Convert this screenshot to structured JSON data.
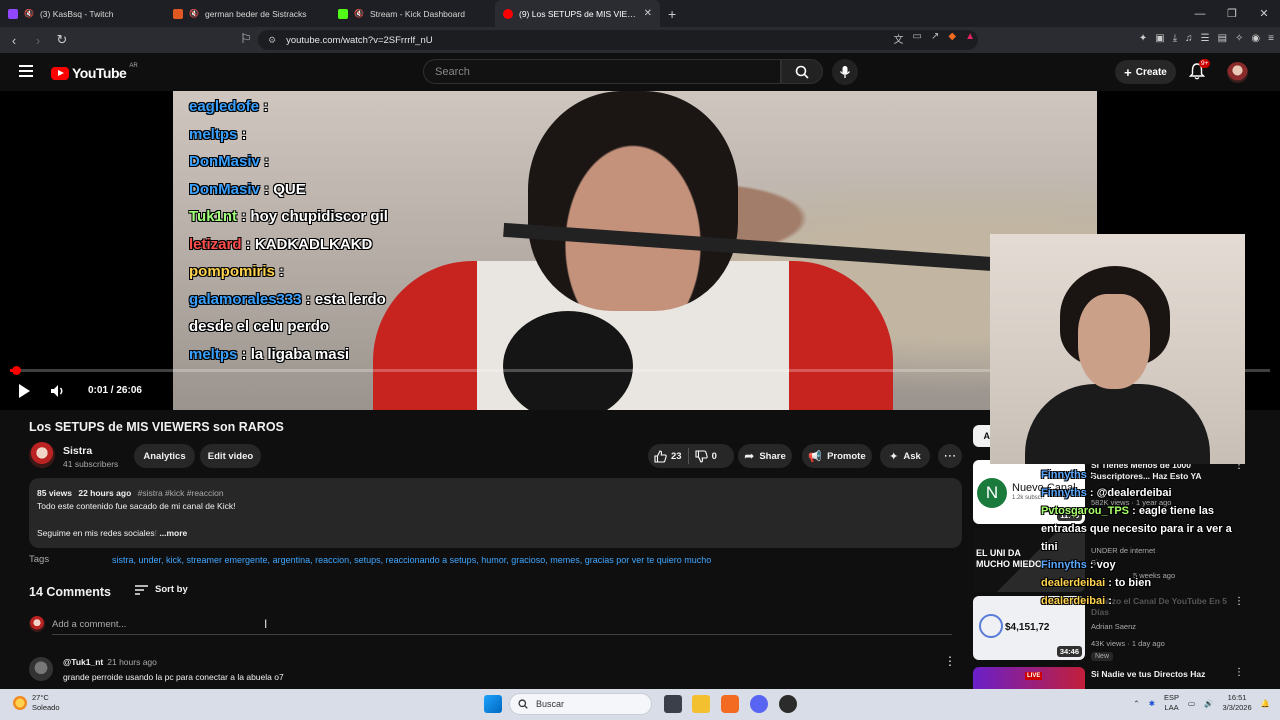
{
  "browser": {
    "tabs": [
      {
        "title": "(3) KasBsq - Twitch",
        "favicon_color": "#9146ff",
        "muted": true,
        "active": false
      },
      {
        "title": "german beder de Sistracks",
        "favicon_color": "#e25822",
        "muted": true,
        "active": false
      },
      {
        "title": "Stream - Kick Dashboard",
        "favicon_color": "#53fc18",
        "muted": true,
        "active": false
      },
      {
        "title": "(9) Los SETUPS de MIS VIEWERS",
        "favicon_color": "#ff0000",
        "muted": false,
        "active": true
      }
    ],
    "new_tab": "+",
    "url": "youtube.com/watch?v=2SFrrrlf_nU"
  },
  "youtube": {
    "logo_text": "YouTube",
    "country_code": "AR",
    "search_placeholder": "Search",
    "create_label": "Create",
    "notification_badge": "9+"
  },
  "player": {
    "time_current": "0:01",
    "time_separator": " / ",
    "time_total": "26:06",
    "progress_fraction": 0.0006,
    "chat_overlay": [
      {
        "user": "eagledofe",
        "sep": " :",
        "msg": "",
        "color": "u1"
      },
      {
        "user": "meltps",
        "sep": " :",
        "msg": "",
        "color": "u1"
      },
      {
        "user": "DonMasiv",
        "sep": " :",
        "msg": "",
        "color": "u1"
      },
      {
        "user": "DonMasiv",
        "sep": " :",
        "msg": " QUE",
        "color": "u1"
      },
      {
        "user": "Tuk1nt",
        "sep": " :",
        "msg": " hoy chupidiscor gil",
        "color": "u5"
      },
      {
        "user": "letizard",
        "sep": " :",
        "msg": " KADKADLKAKD",
        "color": "u3"
      },
      {
        "user": "pompomiris",
        "sep": " :",
        "msg": "",
        "color": "u4"
      },
      {
        "user": "galamorales333",
        "sep": " :",
        "msg": " esta lerdo",
        "color": "u1"
      },
      {
        "user": "",
        "sep": "",
        "msg": "desde el celu perdo",
        "color": "u1"
      },
      {
        "user": "meltps",
        "sep": " :",
        "msg": " la ligaba masi",
        "color": "u1"
      }
    ]
  },
  "video": {
    "title": "Los SETUPS de MIS VIEWERS son RAROS",
    "channel_name": "Sistra",
    "subscribers": "41 subscribers",
    "analytics_label": "Analytics",
    "edit_label": "Edit video",
    "likes": "23",
    "dislikes": "0",
    "share_label": "Share",
    "promote_label": "Promote",
    "ask_label": "Ask",
    "views": "85 views",
    "age": "22 hours ago",
    "hashtags": "#sistra #kick #reaccion",
    "desc_line1": "Todo este contenido fue sacado de mi canal de Kick!",
    "desc_line2": "Seguime en mis redes sociales",
    "desc_faded": "!",
    "more_label": "...more",
    "tags_label": "Tags",
    "tags": "sistra, under, kick, streamer emergente, argentina, reaccion, setups, reaccionando a setups, humor, gracioso, memes, gracias por ver te quiero mucho"
  },
  "comments": {
    "count_label": "14 Comments",
    "sort_label": "Sort by",
    "add_placeholder": "Add a comment...",
    "items": [
      {
        "user": "@Tuk1_nt",
        "ago": "21 hours ago",
        "text": "grande perroide usando la pc para conectar a la abuela o7"
      }
    ]
  },
  "sidebar": {
    "chip_label": "Al",
    "recs": [
      {
        "title": "Si Tienes Menos de 1000 Suscriptores... Haz Esto YA",
        "channel": "Nuevo Canal",
        "channel_sub": "1.2k subscr.",
        "meta": "582K views · 1 year ago",
        "duration": "11:46",
        "thumb_letter": "N"
      },
      {
        "title": "EL UNI DA MUCHO MIEDO",
        "channel": "UNDER de internet",
        "channel_sub": "Sistra",
        "meta": "5 weeks ago",
        "duration": "",
        "thumb_letter": ""
      },
      {
        "title": "Analizo el Canal De YouTube En 5 Días",
        "channel": "Adrian Saenz",
        "channel_sub": "",
        "meta": "43K views · 1 day ago",
        "duration": "34:46",
        "thumb_amount": "$4,151,72",
        "new_badge": "New"
      },
      {
        "title": "Si Nadie ve tus Directos Haz",
        "channel": "",
        "meta": "",
        "duration": "",
        "live_badge": "LIVE"
      }
    ],
    "chat_overlay": [
      {
        "user": "Finnyths",
        "sep": " :",
        "msg": "",
        "cls": "b"
      },
      {
        "user": "Finnyths",
        "sep": " :",
        "msg": " @dealerdeibai",
        "cls": "b"
      },
      {
        "user": "Pvtosgarou_TPS",
        "sep": " :",
        "msg": " eagle tiene las entradas que necesito para ir a ver a tini",
        "cls": "g"
      },
      {
        "user": "Finnyths",
        "sep": " :",
        "msg": " voy",
        "cls": "b"
      },
      {
        "user": "dealerdeibai",
        "sep": " :",
        "msg": " to bien",
        "cls": "y"
      },
      {
        "user": "dealerdeibai",
        "sep": " :",
        "msg": "",
        "cls": "y"
      }
    ]
  },
  "taskbar": {
    "temp": "27°C",
    "weather": "Soleado",
    "search_label": "Buscar",
    "lang1": "ESP",
    "lang2": "LAA",
    "time": "16:51",
    "date": "3/3/2026"
  }
}
